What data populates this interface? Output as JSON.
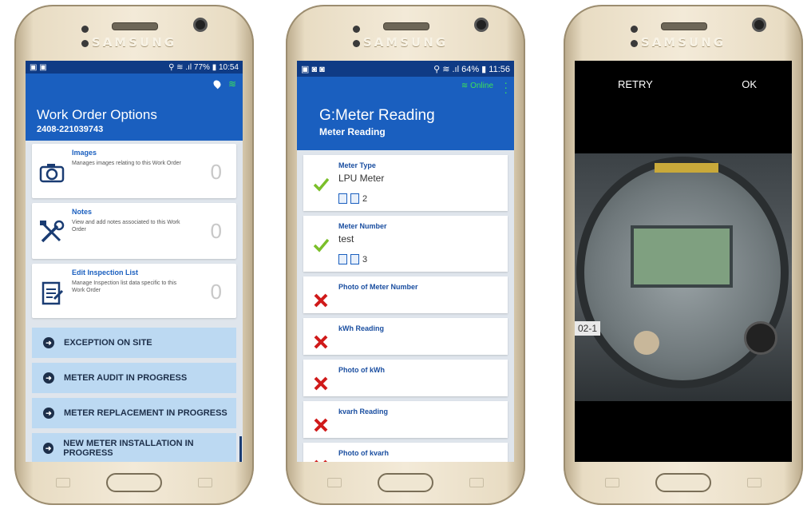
{
  "brand": "SAMSUNG",
  "phone1": {
    "status_left": "▣ ▣",
    "status_right": "⚲ ≋ .ıl 77% ▮ 10:54",
    "title": "Work Order Options",
    "subtitle": "2408-221039743",
    "cards": [
      {
        "title": "Images",
        "desc": "Manages images relating to this Work Order",
        "count": "0",
        "icon": "camera-icon"
      },
      {
        "title": "Notes",
        "desc": "View and add notes associated to this Work Order",
        "count": "0",
        "icon": "tools-icon"
      },
      {
        "title": "Edit Inspection List",
        "desc": "Manage Inspection list data specific to this Work Order",
        "count": "0",
        "icon": "checklist-icon"
      }
    ],
    "actions": [
      "EXCEPTION ON SITE",
      "METER AUDIT IN PROGRESS",
      "METER REPLACEMENT IN PROGRESS",
      "NEW METER INSTALLATION IN PROGRESS"
    ]
  },
  "phone2": {
    "status_right": "⚲ ≋ .ıl 64% ▮ 11:56",
    "online": "Online",
    "title": "G:Meter Reading",
    "subtitle": "Meter Reading",
    "items": [
      {
        "title": "Meter Type",
        "value": "LPU Meter",
        "attachments": "2",
        "status": "ok"
      },
      {
        "title": "Meter Number",
        "value": "test",
        "attachments": "3",
        "status": "ok"
      },
      {
        "title": "Photo of Meter Number",
        "status": "missing"
      },
      {
        "title": "kWh Reading",
        "status": "missing"
      },
      {
        "title": "Photo of kWh",
        "status": "missing"
      },
      {
        "title": "kvarh Reading",
        "status": "missing"
      },
      {
        "title": "Photo of kvarh",
        "status": "missing"
      }
    ]
  },
  "phone3": {
    "retry": "RETRY",
    "ok": "OK",
    "meter_label": "02-1"
  },
  "colors": {
    "primary": "#1a5fbf",
    "action": "#bcd9f2",
    "ok": "#7bbf2a",
    "missing": "#d01a1a"
  }
}
